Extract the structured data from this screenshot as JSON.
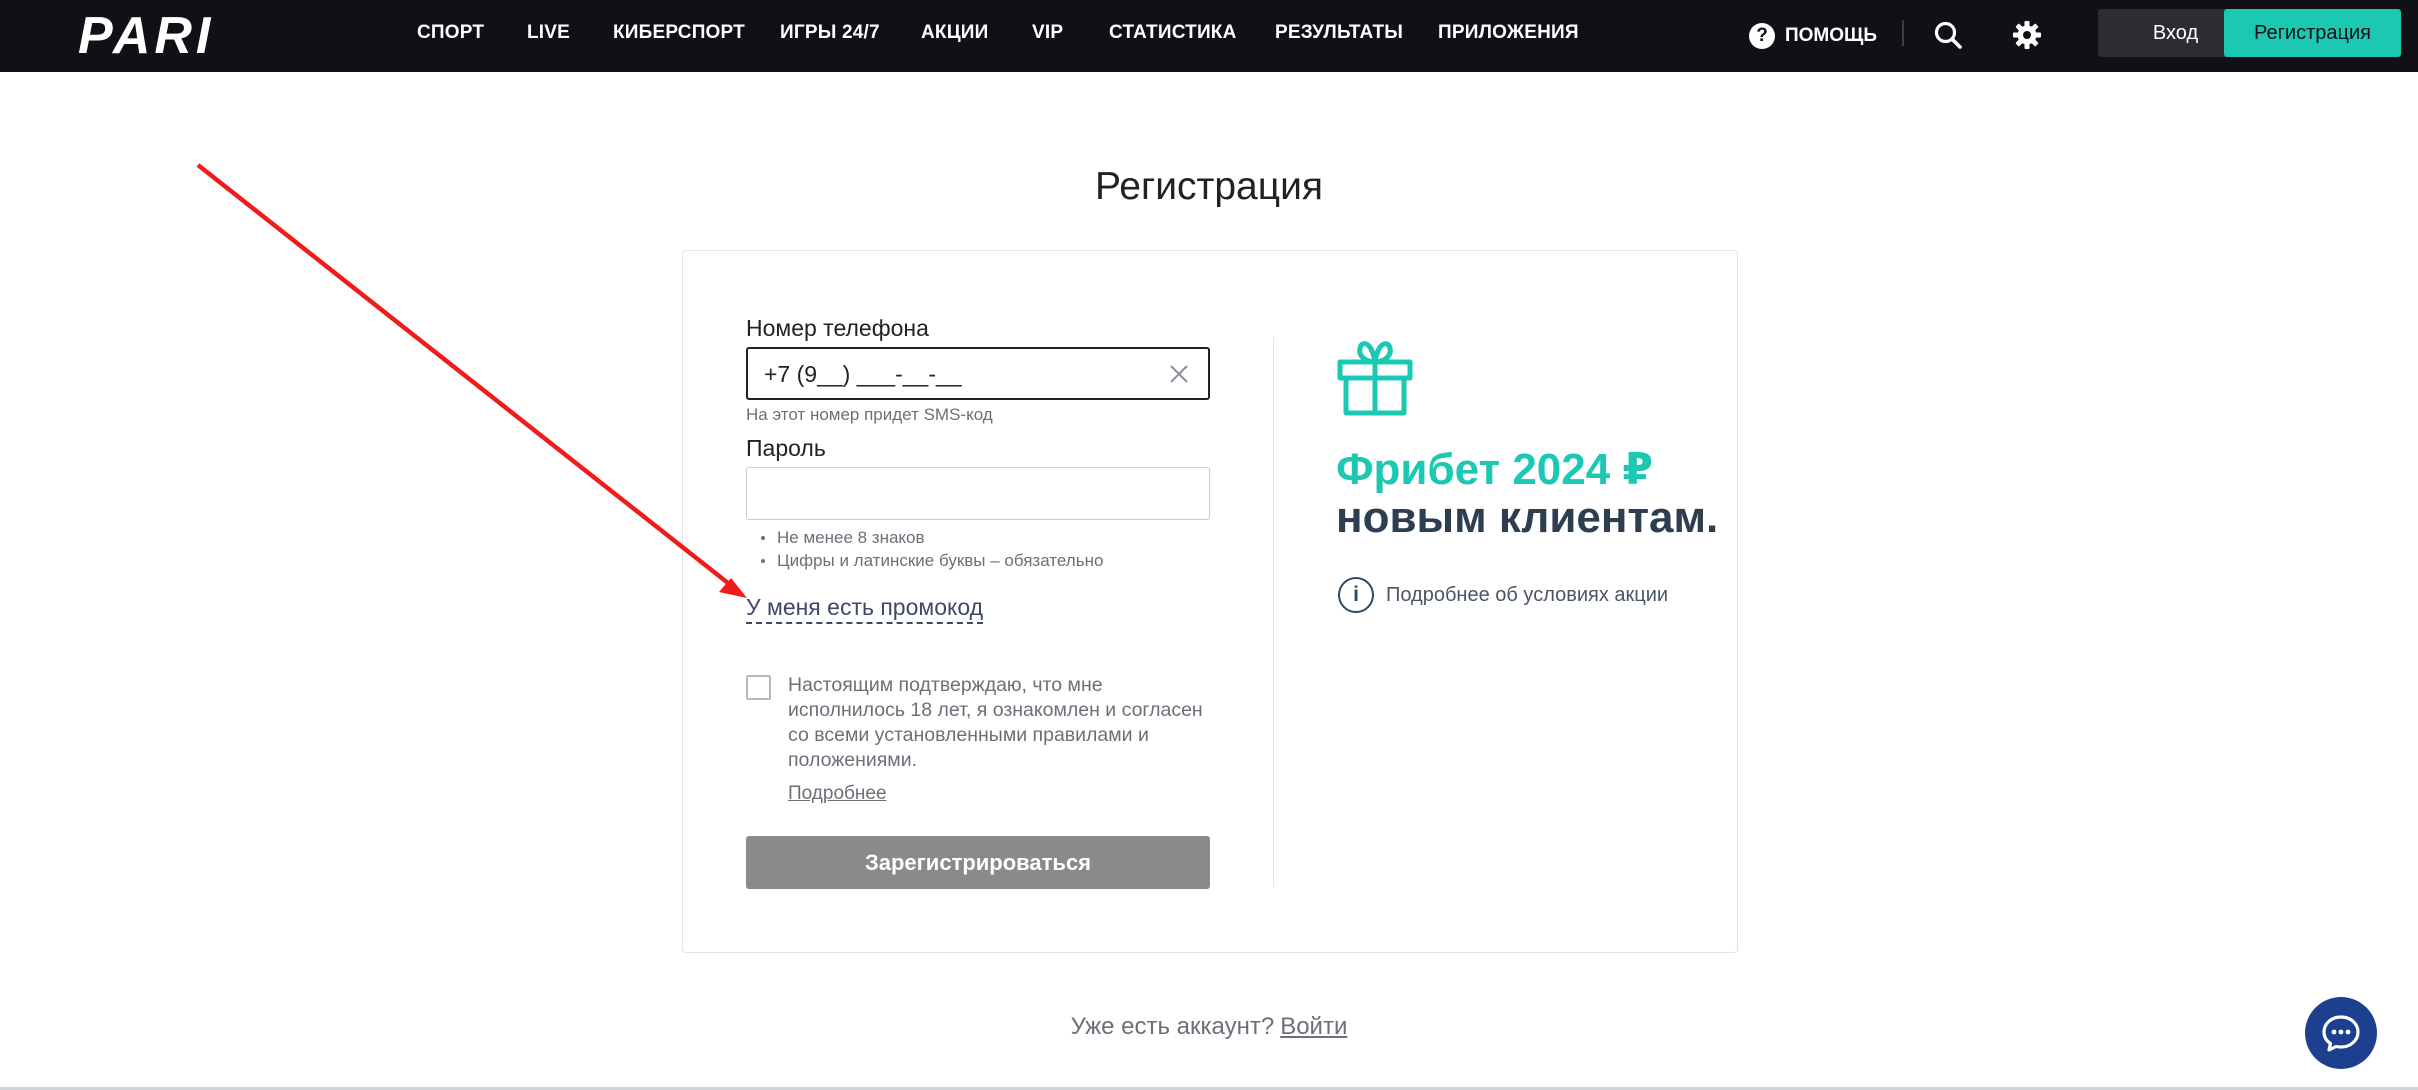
{
  "header": {
    "logo_text": "PARI",
    "nav": [
      {
        "id": "sport",
        "label": "СПОРТ"
      },
      {
        "id": "live",
        "label": "LIVE"
      },
      {
        "id": "esport",
        "label": "КИБЕРСПОРТ"
      },
      {
        "id": "games",
        "label": "ИГРЫ 24/7"
      },
      {
        "id": "promo",
        "label": "АКЦИИ"
      },
      {
        "id": "vip",
        "label": "VIP"
      },
      {
        "id": "stats",
        "label": "СТАТИСТИКА"
      },
      {
        "id": "results",
        "label": "РЕЗУЛЬТАТЫ"
      },
      {
        "id": "apps",
        "label": "ПРИЛОЖЕНИЯ"
      }
    ],
    "help_label": "ПОМОЩЬ",
    "login_label": "Вход",
    "register_label": "Регистрация"
  },
  "page": {
    "title": "Регистрация"
  },
  "form": {
    "phone_label": "Номер телефона",
    "phone_value": "+7 (9__) ___-__-__",
    "phone_hint": "На этот номер придет SMS-код",
    "password_label": "Пароль",
    "password_value": "",
    "password_rules": [
      "Не менее 8 знаков",
      "Цифры и латинские буквы – обязательно"
    ],
    "promo_link": "У меня есть промокод",
    "consent_text": "Настоящим подтверждаю, что мне исполнилось 18 лет, я ознакомлен и согласен со всеми установленными правилами и положениями.",
    "details_link": "Подробнее",
    "submit_label": "Зарегистрироваться"
  },
  "promo": {
    "line1": "Фрибет 2024 ₽",
    "line2": "новым клиентам.",
    "info_label": "Подробнее об условиях акции"
  },
  "footer": {
    "question": "Уже есть аккаунт?",
    "login_link": "Войти"
  },
  "colors": {
    "header_bg": "#0f1116",
    "accent": "#1bc8b1",
    "promo_dark": "#2c3e50",
    "submit_disabled": "#8a8a8a",
    "chat_bg": "#1d3f8f",
    "annotation_arrow": "#f01c1c"
  },
  "icons": {
    "help": "help-icon",
    "search": "search-icon",
    "settings": "gear-icon",
    "clear": "close-icon",
    "gift": "gift-icon",
    "info": "info-icon",
    "chat": "chat-icon"
  }
}
